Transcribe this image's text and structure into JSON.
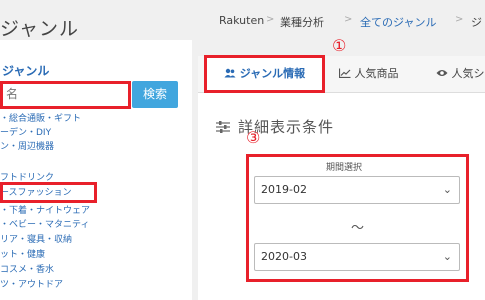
{
  "sidebar": {
    "title": "ジャンル",
    "genre_heading": "ジャンル",
    "search_placeholder": "名",
    "search_button": "検索",
    "categories": [
      "・総合通販・ギフト",
      "ーデン・DIY",
      "ン・周辺機器",
      "フトドリンク",
      "ースファッション",
      "・下着・ナイトウェア",
      "・ベビー・マタニティ",
      "リア・寝具・収納",
      "ット・健康",
      "コスメ・香水",
      "ツ・アウトドア"
    ]
  },
  "breadcrumb": {
    "items": [
      "Rakuten",
      "業種分析",
      "全てのジャンル",
      "ジ"
    ],
    "separator": ">"
  },
  "tabs": [
    {
      "label": "ジャンル情報",
      "icon": "users-icon"
    },
    {
      "label": "人気商品",
      "icon": "chart-icon"
    },
    {
      "label": "人気シ",
      "icon": "eye-icon"
    }
  ],
  "conditions": {
    "title": "詳細表示条件",
    "period_label": "期間選択",
    "start_value": "2019-02",
    "range_separator": "～",
    "end_value": "2020-03"
  },
  "annotations": {
    "marker_1": "①",
    "marker_3": "③",
    "color": "#e8202a"
  }
}
